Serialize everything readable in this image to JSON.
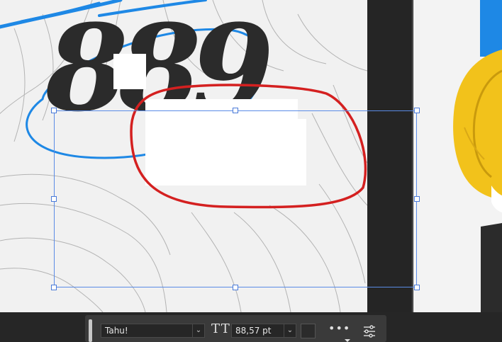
{
  "canvas": {
    "headline_number": "889",
    "accent_colors": {
      "blue": "#1e88e5",
      "red": "#d42020",
      "yellow": "#f2c21b",
      "dark": "#2b2b2b"
    }
  },
  "text_toolbar": {
    "font_family": "Tahu!",
    "font_size": "88,57 pt",
    "font_size_icon": "text-size-icon",
    "text_color": "#2b2b2b",
    "more_icon": "more-options-icon",
    "settings_icon": "sliders-icon"
  }
}
